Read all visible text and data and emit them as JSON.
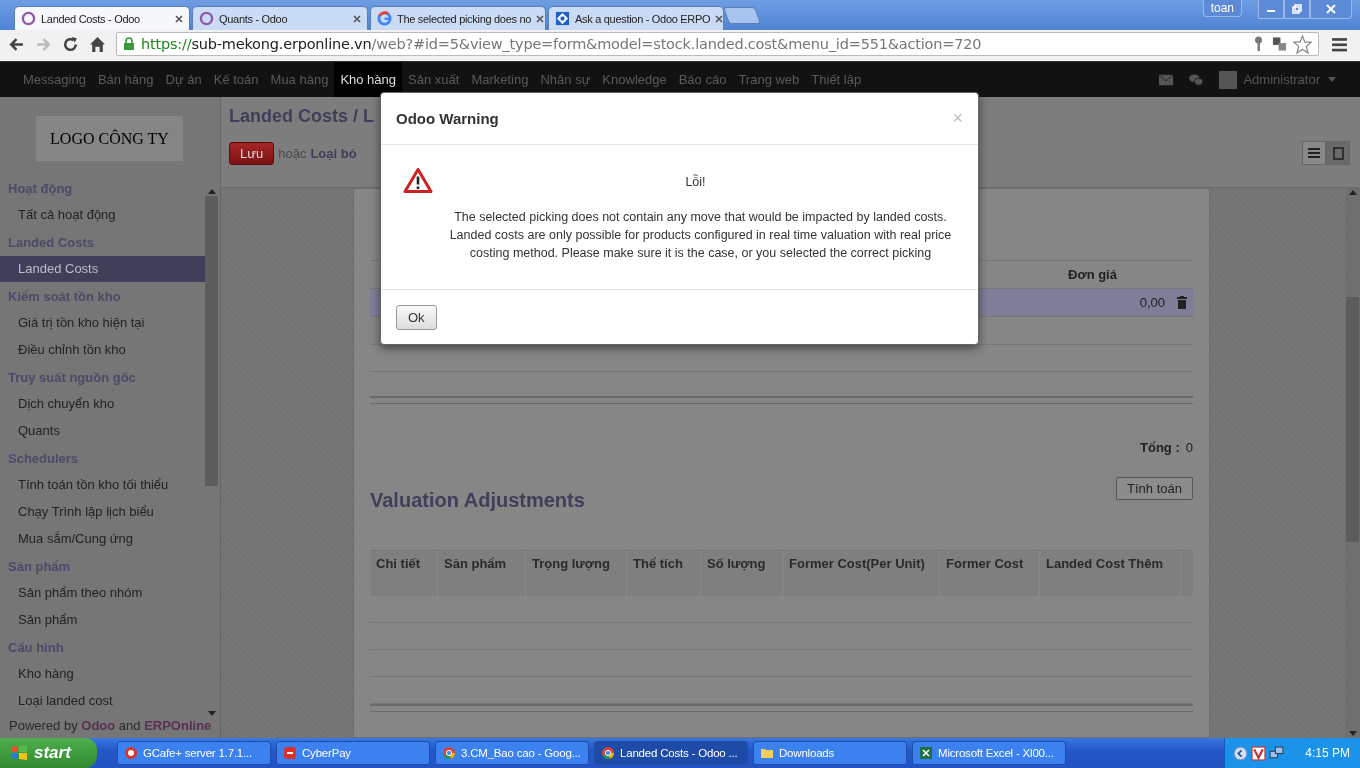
{
  "browser": {
    "tabs": [
      {
        "title": "Landed Costs - Odoo",
        "kind": "odoo",
        "selected": true
      },
      {
        "title": "Quants - Odoo",
        "kind": "odoo",
        "selected": false
      },
      {
        "title": "The selected picking does no",
        "kind": "google",
        "selected": false
      },
      {
        "title": "Ask a question - Odoo ERPO",
        "kind": "grid",
        "selected": false
      }
    ],
    "user": "toan",
    "url": {
      "scheme": "https://",
      "host": "sub-mekong.erponline.vn",
      "path": "/web?#id=5&view_type=form&model=stock.landed.cost&menu_id=551&action=720"
    }
  },
  "top_menu": {
    "items": [
      {
        "label": "Messaging",
        "selected": false
      },
      {
        "label": "Bán hàng",
        "selected": false
      },
      {
        "label": "Dự án",
        "selected": false
      },
      {
        "label": "Kế toán",
        "selected": false
      },
      {
        "label": "Mua hàng",
        "selected": false
      },
      {
        "label": "Kho hàng",
        "selected": true
      },
      {
        "label": "Sản xuất",
        "selected": false
      },
      {
        "label": "Marketing",
        "selected": false
      },
      {
        "label": "Nhân sự",
        "selected": false
      },
      {
        "label": "Knowledge",
        "selected": false
      },
      {
        "label": "Báo cáo",
        "selected": false
      },
      {
        "label": "Trang web",
        "selected": false
      },
      {
        "label": "Thiết lập",
        "selected": false
      }
    ],
    "user": "Administrator"
  },
  "sidebar": {
    "logo": "LOGO CÔNG TY",
    "sections": [
      {
        "heading": "Hoạt động",
        "items": [
          {
            "label": "Tất cả hoạt động",
            "selected": false
          }
        ]
      },
      {
        "heading": "Landed Costs",
        "items": [
          {
            "label": "Landed Costs",
            "selected": true
          }
        ]
      },
      {
        "heading": "Kiểm soát tồn kho",
        "items": [
          {
            "label": "Giá trị tồn kho hiện tại",
            "selected": false
          },
          {
            "label": "Điều chỉnh tồn kho",
            "selected": false
          }
        ]
      },
      {
        "heading": "Truy suất nguồn gốc",
        "items": [
          {
            "label": "Dịch chuyển kho",
            "selected": false
          },
          {
            "label": "Quants",
            "selected": false
          }
        ]
      },
      {
        "heading": "Schedulers",
        "items": [
          {
            "label": "Tính toán tồn kho tối thiểu",
            "selected": false
          },
          {
            "label": "Chạy Trình lập lịch biểu",
            "selected": false
          },
          {
            "label": "Mua sắm/Cung ứng",
            "selected": false
          }
        ]
      },
      {
        "heading": "Sản phẩm",
        "items": [
          {
            "label": "Sản phẩm theo nhóm",
            "selected": false
          },
          {
            "label": "Sản phẩm",
            "selected": false
          }
        ]
      },
      {
        "heading": "Cấu hình",
        "items": [
          {
            "label": "Kho hàng",
            "selected": false
          },
          {
            "label": "Loại landed cost",
            "selected": false
          }
        ]
      }
    ],
    "footer": "Powered by **Odoo** and **ERPOnline**"
  },
  "form": {
    "breadcrumb": "Landed Costs / L",
    "save_button": "Lưu",
    "or": "hoặc",
    "discard": "Loại bỏ",
    "views": [
      {
        "kind": "list",
        "selected": false
      },
      {
        "kind": "form",
        "selected": true
      }
    ],
    "cost_lines": {
      "columns": [
        "Đơn giá"
      ],
      "rows": [
        {
          "cells": [
            "0,00"
          ],
          "editing": true
        }
      ]
    },
    "total_label": "Tổng :",
    "total": "0",
    "compute_button": "Tính toán",
    "valuation": {
      "title": "Valuation Adjustments",
      "columns": [
        "Chi tiết",
        "Sản phẩm",
        "Trọng lượng",
        "Thể tích",
        "Số lượng",
        "Former Cost(Per Unit)",
        "Former Cost",
        "Landed Cost Thêm"
      ]
    }
  },
  "dialog": {
    "title": "Odoo Warning",
    "close": "×",
    "heading": "Lỗi!",
    "message": "The selected picking does not contain any move that would be impacted by landed costs. Landed costs are only possible for products configured in real time valuation with real price costing method. Please make sure it is the case, or you selected the correct picking",
    "button": "Ok"
  },
  "taskbar": {
    "start": "start",
    "tasks": [
      {
        "label": "GCafe+ server 1.7.1...",
        "kind": "gcafe",
        "selected": false
      },
      {
        "label": "CyberPay",
        "kind": "cyberpay",
        "selected": false
      },
      {
        "label": "3.CM_Bao cao - Goog...",
        "kind": "chrome",
        "selected": false
      },
      {
        "label": "Landed Costs - Odoo ...",
        "kind": "chrome",
        "selected": true
      },
      {
        "label": "Downloads",
        "kind": "folder",
        "selected": false
      },
      {
        "label": "Microsoft Excel - Xl00...",
        "kind": "excel",
        "selected": false
      }
    ],
    "clock": "4:15 PM"
  }
}
